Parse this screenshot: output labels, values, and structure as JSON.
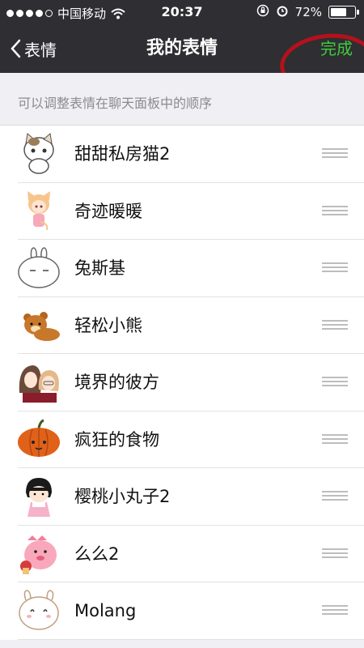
{
  "status_bar": {
    "carrier": "中国移动",
    "time": "20:37",
    "battery_percent": "72%",
    "battery_level": 0.72
  },
  "nav": {
    "back_label": "表情",
    "title": "我的表情",
    "done_label": "完成"
  },
  "hint": "可以调整表情在聊天面板中的顺序",
  "stickers": [
    {
      "name": "甜甜私房猫2",
      "icon": "cat-sticker-icon"
    },
    {
      "name": "奇迹暖暖",
      "icon": "girl-sticker-icon"
    },
    {
      "name": "兔斯基",
      "icon": "rabbit-sticker-icon"
    },
    {
      "name": "轻松小熊",
      "icon": "bear-sticker-icon"
    },
    {
      "name": "境界的彼方",
      "icon": "anime-sticker-icon"
    },
    {
      "name": "疯狂的食物",
      "icon": "pumpkin-sticker-icon"
    },
    {
      "name": "樱桃小丸子2",
      "icon": "maruko-sticker-icon"
    },
    {
      "name": "么么2",
      "icon": "dino-sticker-icon"
    },
    {
      "name": "Molang",
      "icon": "molang-sticker-icon"
    }
  ],
  "colors": {
    "nav_bg": "#2e2e33",
    "done_green": "#3fcd3a",
    "annotation_red": "#b3121b"
  }
}
